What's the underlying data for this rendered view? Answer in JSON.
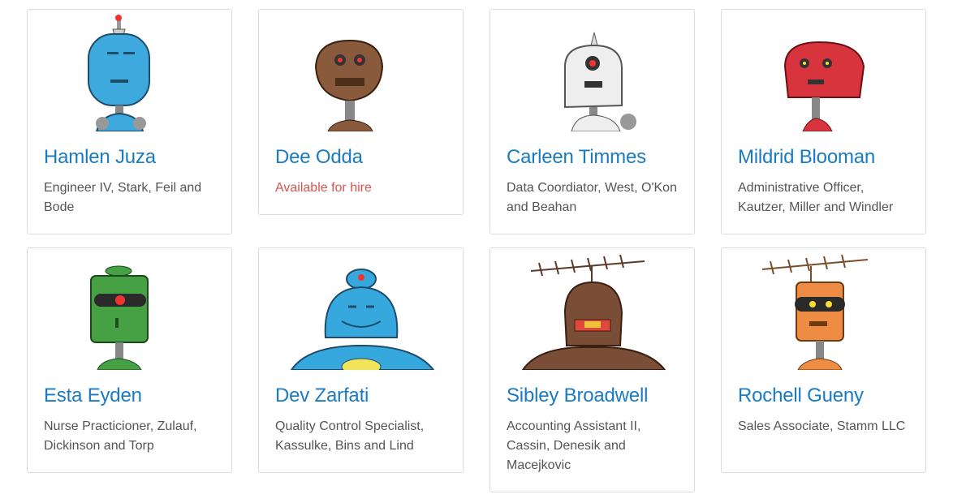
{
  "cards": [
    {
      "name": "Hamlen Juza",
      "subtitle": "Engineer IV, Stark, Feil and Bode",
      "icon": "blue-robot-antenna-icon",
      "color": "#3ea9dc"
    },
    {
      "name": "Dee Odda",
      "subtitle": "Available for hire",
      "icon": "brown-robot-icon",
      "color": "#8a5a3c"
    },
    {
      "name": "Carleen Timmes",
      "subtitle": "Data Coordiator, West, O'Kon and Beahan",
      "icon": "white-robot-spike-icon",
      "color": "#eeeeee"
    },
    {
      "name": "Mildrid Blooman",
      "subtitle": "Administrative Officer, Kautzer, Miller and Windler",
      "icon": "red-robot-icon",
      "color": "#d8343d"
    },
    {
      "name": "Esta Eyden",
      "subtitle": "Nurse Practicioner, Zulauf, Dickinson and Torp",
      "icon": "green-robot-icon",
      "color": "#45a144"
    },
    {
      "name": "Dev Zarfati",
      "subtitle": "Quality Control Specialist, Kassulke, Bins and Lind",
      "icon": "blue-robot-round-icon",
      "color": "#36a8dd"
    },
    {
      "name": "Sibley Broadwell",
      "subtitle": "Accounting Assistant II, Cassin, Denesik and Macejkovic",
      "icon": "brown-robot-antenna-icon",
      "color": "#7a4e36"
    },
    {
      "name": "Rochell Gueny",
      "subtitle": "Sales Associate, Stamm LLC",
      "icon": "orange-robot-antenna-icon",
      "color": "#ef8c43"
    }
  ]
}
